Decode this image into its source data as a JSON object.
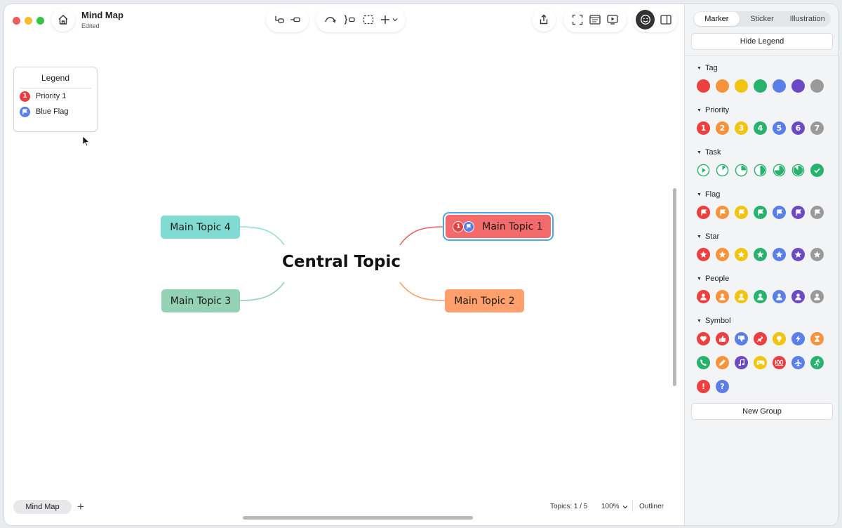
{
  "window": {
    "title": "Mind Map",
    "subtitle": "Edited"
  },
  "legend": {
    "title": "Legend",
    "items": [
      {
        "label": "Priority 1",
        "marker": "priority-1-icon",
        "color": "#e84040"
      },
      {
        "label": "Blue Flag",
        "marker": "blue-flag-icon",
        "color": "#5b7fe8"
      }
    ]
  },
  "mindmap": {
    "central": "Central Topic",
    "topics": [
      {
        "label": "Main Topic 1",
        "color": "#f26a6a",
        "line": "#e86060"
      },
      {
        "label": "Main Topic 2",
        "color": "#ff9f6b",
        "line": "#f5a070"
      },
      {
        "label": "Main Topic 3",
        "color": "#93d2b4",
        "line": "#8dd0ba"
      },
      {
        "label": "Main Topic 4",
        "color": "#80dcd2",
        "line": "#90dcd4"
      }
    ]
  },
  "bottom": {
    "sheet_tab": "Mind Map",
    "add": "+",
    "topics_count": "Topics: 1 / 5",
    "zoom": "100%",
    "outliner": "Outliner"
  },
  "panel": {
    "tabs": [
      "Marker",
      "Sticker",
      "Illustration"
    ],
    "active_tab": "Marker",
    "hide_legend": "Hide Legend",
    "new_group": "New Group",
    "groups": {
      "tag": "Tag",
      "priority": "Priority",
      "task": "Task",
      "flag": "Flag",
      "star": "Star",
      "people": "People",
      "symbol": "Symbol"
    },
    "priority_numbers": [
      "1",
      "2",
      "3",
      "4",
      "5",
      "6",
      "7"
    ],
    "palette": [
      "#ec3f3f",
      "#f7933a",
      "#f1c40f",
      "#27b26e",
      "#5b7fe8",
      "#6c4ac4",
      "#9a9a9a"
    ],
    "task_color": "#27b26e"
  }
}
